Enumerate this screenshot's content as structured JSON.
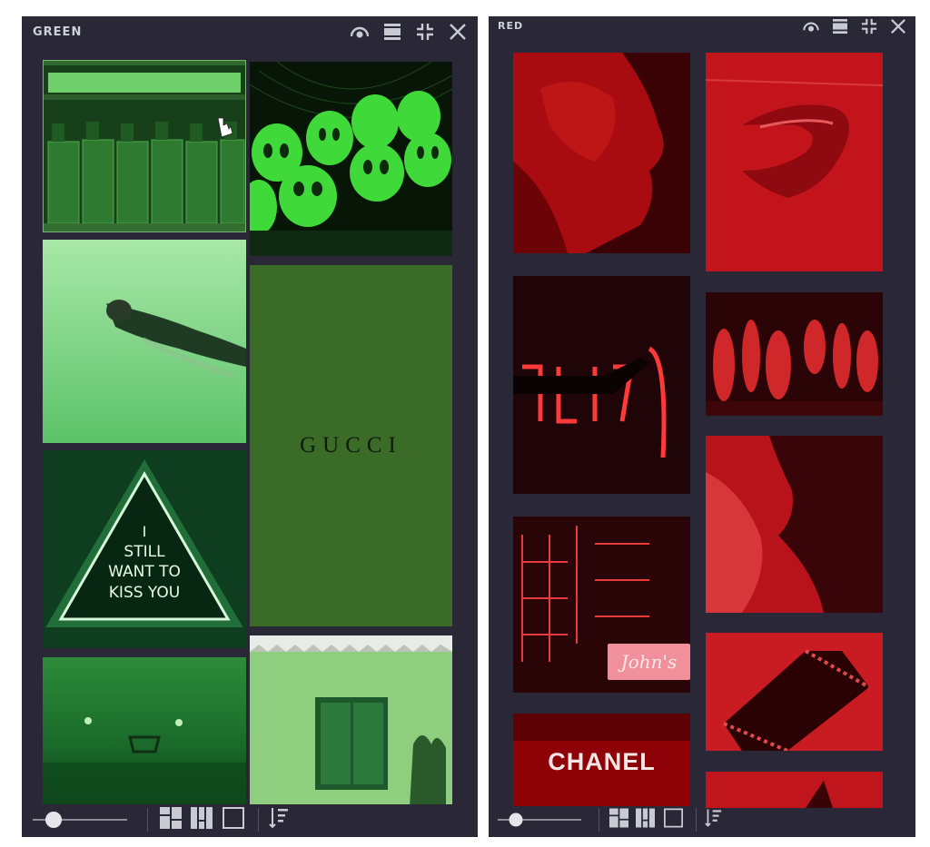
{
  "green_panel": {
    "title": "GREEN",
    "tiles": {
      "gucci_text": "GUCCI",
      "neon_sign_lines": [
        "I",
        "STILL",
        "WANT TO",
        "KISS YOU"
      ]
    },
    "slider_level": 0.2
  },
  "red_panel": {
    "title": "RED",
    "tiles": {
      "chanel_text": "CHANEL",
      "johns_sign_text": "John's"
    },
    "slider_level": 0.2
  },
  "toolbar_icons": [
    "eye-icon",
    "single-row-icon",
    "collapse-icon",
    "close-icon"
  ],
  "bottom_icons": [
    "mosaic-layout-icon",
    "column-layout-icon",
    "single-layout-icon",
    "sort-icon"
  ],
  "colors": {
    "panel_bg": "#2a2836",
    "title_text": "#cfd0d8",
    "green_accent": "#3b6c27",
    "red_accent": "#b00a12"
  }
}
